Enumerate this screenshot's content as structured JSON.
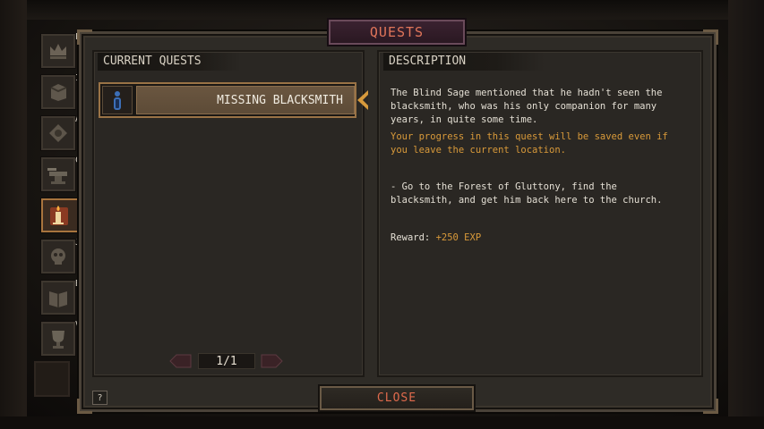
{
  "window": {
    "title": "QUESTS",
    "close_label": "CLOSE",
    "help_label": "?"
  },
  "sidebar": {
    "tabs": [
      {
        "hotkey": "P",
        "icon": "crown-icon"
      },
      {
        "hotkey": "I",
        "icon": "inventory-icon"
      },
      {
        "hotkey": "A",
        "icon": "abilities-icon"
      },
      {
        "hotkey": "C",
        "icon": "anvil-icon"
      },
      {
        "hotkey": "",
        "icon": "quest-candle-icon",
        "active": true
      },
      {
        "hotkey": "J",
        "icon": "journal-skull-icon"
      },
      {
        "hotkey": "B",
        "icon": "book-icon"
      },
      {
        "hotkey": "V",
        "icon": "trophy-icon"
      }
    ]
  },
  "quests": {
    "header": "CURRENT QUESTS",
    "items": [
      {
        "label": "MISSING BLACKSMITH",
        "icon": "info-icon"
      }
    ],
    "pagination": "1/1"
  },
  "description": {
    "header": "DESCRIPTION",
    "main": "The Blind Sage mentioned that he hadn't seen the\nblacksmith, who was his only companion for many\nyears, in quite some time.",
    "note": "Your progress in this quest will be saved even if\nyou leave the current location.",
    "objective": "- Go to the Forest of Gluttony, find the\nblacksmith, and get him back here to the church.",
    "reward_label": "Reward: ",
    "reward_value": "+250 EXP"
  },
  "colors": {
    "title_text": "#e0755a",
    "highlight_text": "#d99a3a",
    "selected_border": "#9a7346"
  }
}
